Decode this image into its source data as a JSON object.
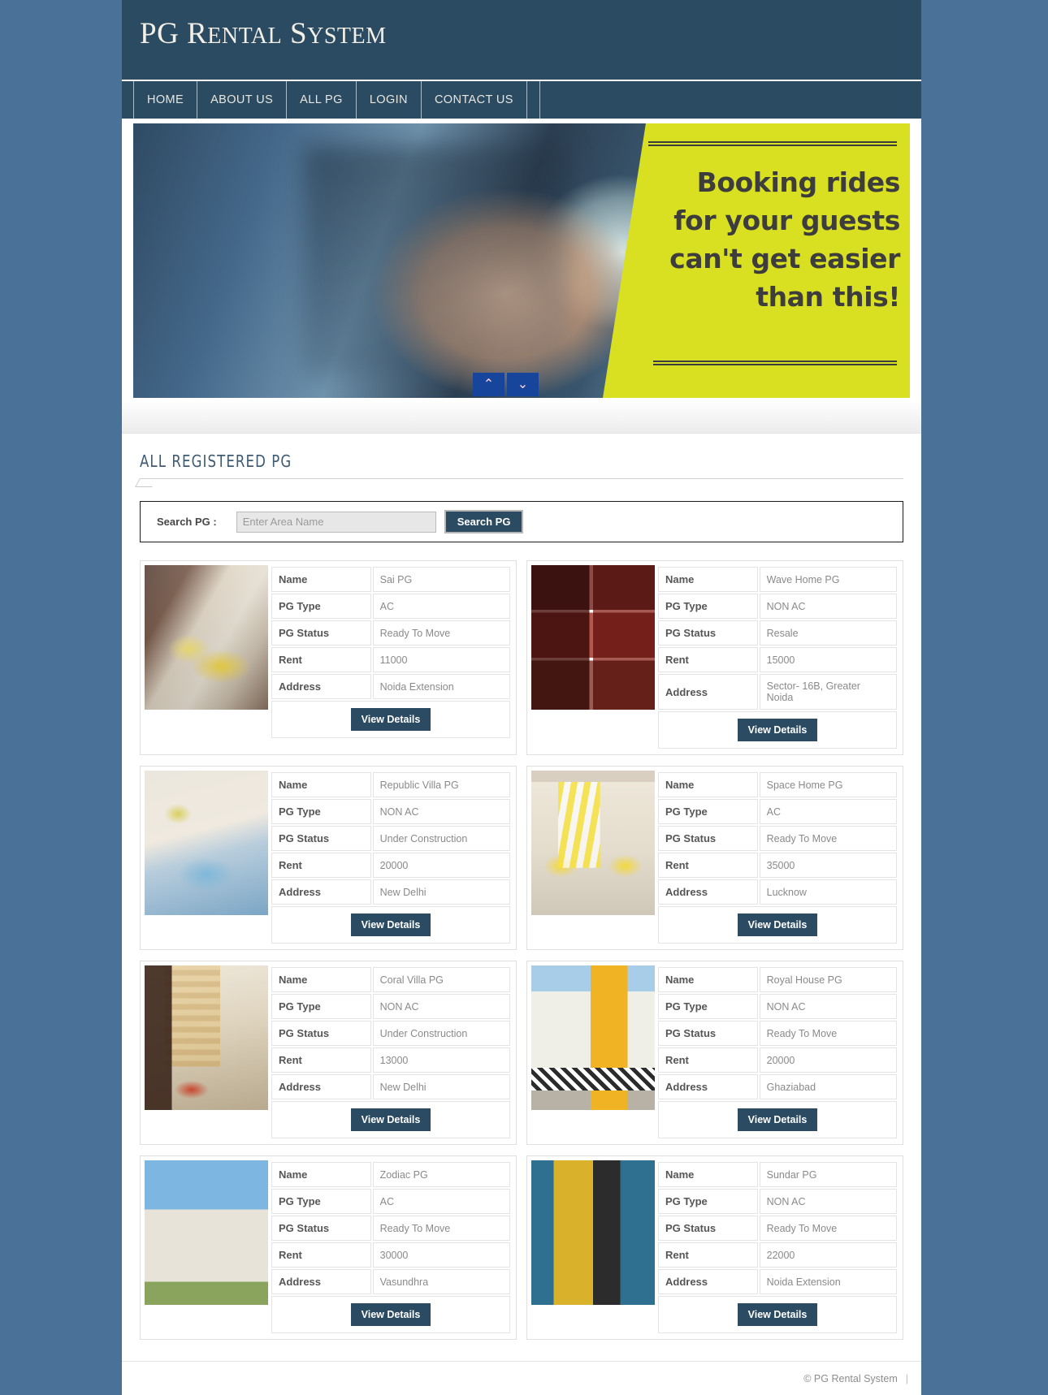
{
  "header": {
    "title_parts": [
      {
        "text": "PG",
        "style": "cap"
      },
      {
        "text": " R",
        "style": "cap"
      },
      {
        "text": "ENTAL",
        "style": "sc"
      },
      {
        "text": " S",
        "style": "cap"
      },
      {
        "text": "YSTEM",
        "style": "sc"
      }
    ],
    "title_plain": "PG Rental System"
  },
  "nav": {
    "items": [
      {
        "label": "HOME",
        "name": "nav-item-home"
      },
      {
        "label": "ABOUT US",
        "name": "nav-item-about-us"
      },
      {
        "label": "ALL PG",
        "name": "nav-item-all-pg"
      },
      {
        "label": "LOGIN",
        "name": "nav-item-login"
      },
      {
        "label": "CONTACT US",
        "name": "nav-item-contact-us"
      }
    ]
  },
  "banner": {
    "lines": [
      "Booking rides",
      "for your guests",
      "can't get easier",
      "than this!"
    ],
    "line1": "Booking rides",
    "line2": "for your guests",
    "line3": "can't get easier",
    "line4": "than this!",
    "panel_color": "#d9e021",
    "controls": {
      "up": "⌃",
      "down": "⌄"
    }
  },
  "main": {
    "section_title": "ALL REGISTERED PG",
    "search": {
      "label": "Search PG :",
      "placeholder": "Enter Area Name",
      "value": "",
      "button_label": "Search PG"
    },
    "table_labels": {
      "name": "Name",
      "pg_type": "PG Type",
      "pg_status": "PG Status",
      "rent": "Rent",
      "address": "Address"
    },
    "view_details_label": "View Details",
    "pg_listings": [
      {
        "name": "Sai PG",
        "pg_type": "AC",
        "pg_status": "Ready To Move",
        "rent": "11000",
        "address": "Noida Extension",
        "thumb_class": "th-room1"
      },
      {
        "name": "Wave Home PG",
        "pg_type": "NON AC",
        "pg_status": "Resale",
        "rent": "15000",
        "address": "Sector- 16B, Greater Noida",
        "thumb_class": "th-collage"
      },
      {
        "name": "Republic Villa PG",
        "pg_type": "NON AC",
        "pg_status": "Under Construction",
        "rent": "20000",
        "address": "New Delhi",
        "thumb_class": "th-blue"
      },
      {
        "name": "Space Home PG",
        "pg_type": "AC",
        "pg_status": "Ready To Move",
        "rent": "35000",
        "address": "Lucknow",
        "thumb_class": "th-yellowroom"
      },
      {
        "name": "Coral Villa PG",
        "pg_type": "NON AC",
        "pg_status": "Under Construction",
        "rent": "13000",
        "address": "New Delhi",
        "thumb_class": "th-brownroom"
      },
      {
        "name": "Royal House PG",
        "pg_type": "NON AC",
        "pg_status": "Ready To Move",
        "rent": "20000",
        "address": "Ghaziabad",
        "thumb_class": "th-yellowhouse"
      },
      {
        "name": "Zodiac PG",
        "pg_type": "AC",
        "pg_status": "Ready To Move",
        "rent": "30000",
        "address": "Vasundhra",
        "thumb_class": "th-apartment"
      },
      {
        "name": "Sundar PG",
        "pg_type": "NON AC",
        "pg_status": "Ready To Move",
        "rent": "22000",
        "address": "Noida Extension",
        "thumb_class": "th-modern"
      }
    ]
  },
  "footer": {
    "copyright": "© PG Rental System",
    "separator": "|"
  },
  "colors": {
    "header_navy": "#2b4b63",
    "page_background": "#4a7198",
    "accent_yellow": "#d9e021",
    "carousel_blue": "#16459b"
  }
}
